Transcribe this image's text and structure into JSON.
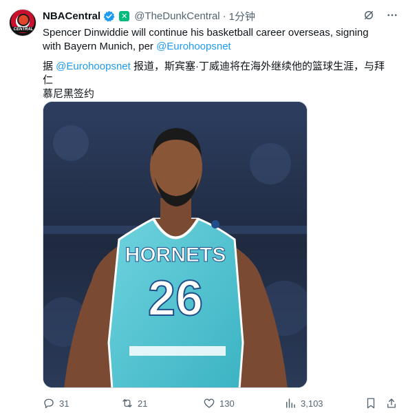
{
  "author": {
    "name": "NBACentral",
    "handle": "@TheDunkCentral",
    "separator": "·",
    "time": "1分钟",
    "avatar_text": "CENTRAL"
  },
  "tweet": {
    "text_en_line1": "Spencer Dinwiddie will continue his basketball career overseas, signing",
    "text_en_line2_prefix": "with Bayern Munich, per ",
    "text_en_mention": "@Eurohoopsnet",
    "text_zh_prefix": "据 ",
    "text_zh_mention": "@Eurohoopsnet",
    "text_zh_line1_rest": " 报道，斯宾塞·丁威迪将在海外继续他的篮球生涯，与拜仁",
    "text_zh_line2": "慕尼黑签约"
  },
  "media": {
    "jersey_team": "HORNETS",
    "jersey_number": "26",
    "alt": "Player in teal Hornets jersey number 26"
  },
  "actions": {
    "replies": "31",
    "reposts": "21",
    "likes": "130",
    "views": "3,103"
  },
  "icons": {
    "verified": "verified-badge-icon",
    "grok": "grok-icon",
    "more": "more-icon"
  },
  "colors": {
    "link": "#1d9bf0",
    "muted": "#536471",
    "verified": "#1d9bf0",
    "jersey": "#4fc3d0"
  }
}
